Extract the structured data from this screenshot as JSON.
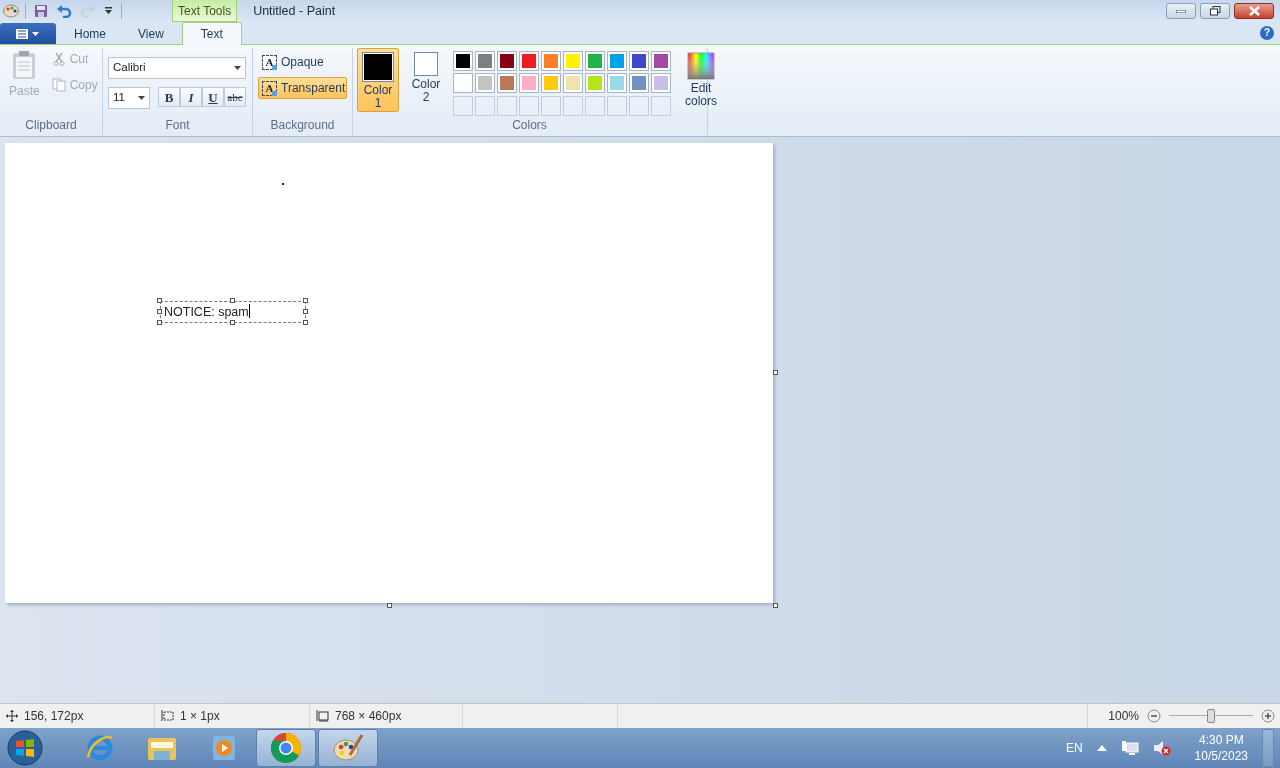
{
  "title_bar": {
    "context_tab": "Text Tools",
    "title": "Untitled - Paint"
  },
  "quick_access": [
    {
      "kind": "save",
      "disabled": false
    },
    {
      "kind": "undo",
      "disabled": false
    },
    {
      "kind": "redo",
      "disabled": true
    },
    {
      "kind": "customize",
      "disabled": false
    }
  ],
  "help": "?",
  "tabs": [
    {
      "label": "Home",
      "selected": false
    },
    {
      "label": "View",
      "selected": false
    },
    {
      "label": "Text",
      "selected": true
    }
  ],
  "clipboard": {
    "label": "Clipboard",
    "paste": {
      "label": "Paste",
      "disabled": true
    },
    "cut": {
      "label": "Cut",
      "disabled": true
    },
    "copy": {
      "label": "Copy",
      "disabled": true
    }
  },
  "font": {
    "label": "Font",
    "family": "Calibri",
    "size": "11",
    "styles": [
      {
        "label": "B",
        "kind": "bold"
      },
      {
        "label": "I",
        "kind": "italic"
      },
      {
        "label": "U",
        "kind": "underline"
      },
      {
        "label": "abc",
        "kind": "strike"
      }
    ]
  },
  "background": {
    "label": "Background",
    "options": [
      {
        "label": "Opaque",
        "icon_text": "A",
        "selected": false
      },
      {
        "label": "Transparent",
        "icon_text": "A",
        "selected": true
      }
    ]
  },
  "colors": {
    "label": "Colors",
    "color_1": {
      "label": "Color 1",
      "color": "#000000",
      "selected": true
    },
    "color_2": {
      "label": "Color 2",
      "color": "#ffffff",
      "selected": false
    },
    "palette": [
      {
        "color": "#000000"
      },
      {
        "color": "#7f7f7f"
      },
      {
        "color": "#880015"
      },
      {
        "color": "#ed1c24"
      },
      {
        "color": "#ff7f27"
      },
      {
        "color": "#fff200"
      },
      {
        "color": "#22b14c"
      },
      {
        "color": "#00a2e8"
      },
      {
        "color": "#3f48cc"
      },
      {
        "color": "#a349a4"
      },
      {
        "color": "#ffffff"
      },
      {
        "color": "#c3c3c3"
      },
      {
        "color": "#b97a57"
      },
      {
        "color": "#ffaec9"
      },
      {
        "color": "#ffc90e"
      },
      {
        "color": "#efe4b0"
      },
      {
        "color": "#b5e61d"
      },
      {
        "color": "#99d9ea"
      },
      {
        "color": "#7092be"
      },
      {
        "color": "#c8bfe7"
      }
    ],
    "edit_colors": "Edit colors"
  },
  "canvas": {
    "text_box": "NOTICE: spam"
  },
  "status_bar": {
    "cursor": "156, 172px",
    "selection": "1 × 1px",
    "size": "768 × 460px",
    "zoom": "100%",
    "zoom_slider": {
      "level": 0.5
    }
  },
  "taskbar": {
    "apps": [
      {
        "kind": "ie",
        "running": false
      },
      {
        "kind": "explorer",
        "running": false
      },
      {
        "kind": "media",
        "running": false
      },
      {
        "kind": "chrome",
        "running": true
      },
      {
        "kind": "paint",
        "running": true
      }
    ],
    "language": "EN",
    "time": "4:30 PM",
    "date": "10/5/2023"
  }
}
